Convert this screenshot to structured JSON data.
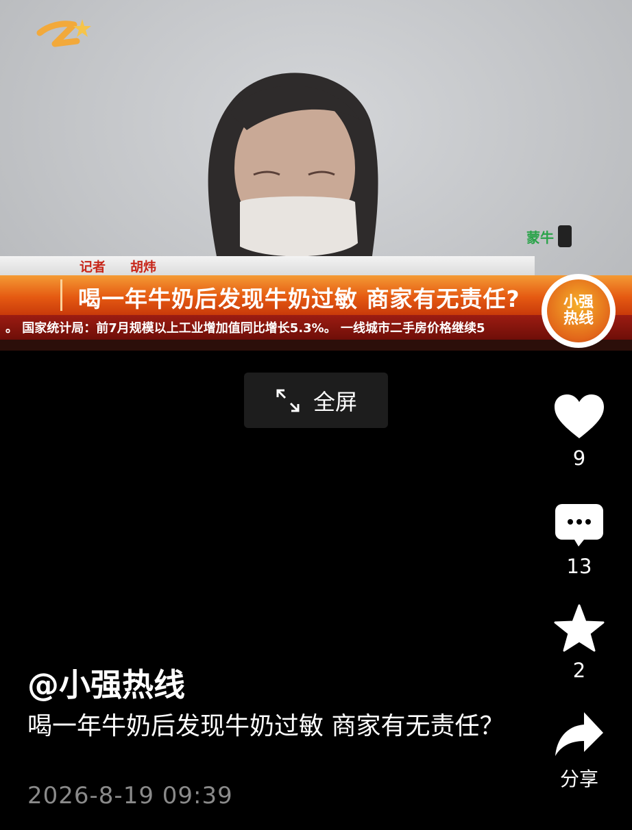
{
  "video": {
    "reporter_label": "记者",
    "reporter_name": "胡炜",
    "headline": "喝一年牛奶后发现牛奶过敏 商家有无责任?",
    "ticker": "。 国家统计局：前7月规模以上工业增加值同比增长5.3%。 一线城市二手房价格继续5",
    "sponsor_text": "蒙牛",
    "program_badge_text": "小强热线",
    "channel_logo_icon": "zhejiang-tv-logo"
  },
  "player": {
    "fullscreen_label": "全屏"
  },
  "actions": {
    "like_count": "9",
    "comment_count": "13",
    "favorite_count": "2",
    "share_label": "分享"
  },
  "post": {
    "author": "@小强热线",
    "caption": "喝一年牛奶后发现牛奶过敏 商家有无责任？",
    "timestamp": "2026-8-19 09:39"
  },
  "colors": {
    "background": "#000000",
    "headline_orange": "#e55a12",
    "ticker_red": "#9c1c12",
    "timestamp_gray": "#8a8a8a",
    "icon_white": "#ffffff"
  }
}
